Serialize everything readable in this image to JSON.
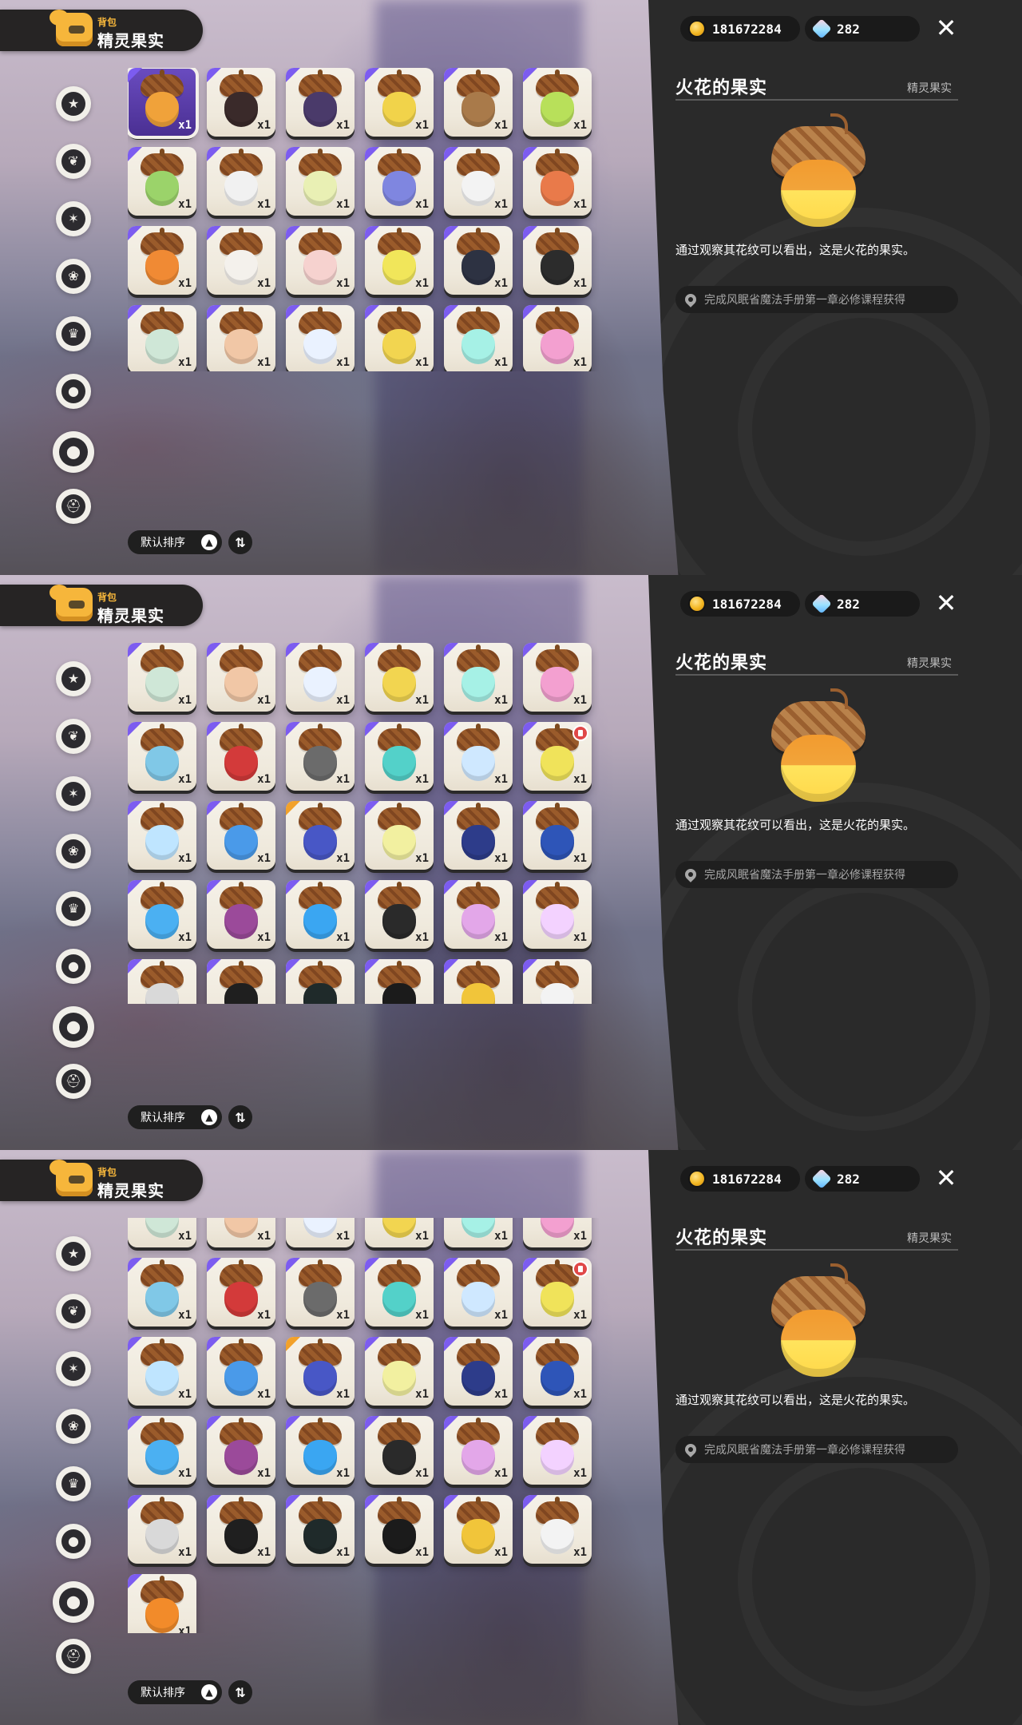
{
  "header": {
    "supertitle": "背包",
    "title": "精灵果实"
  },
  "currency": {
    "coins": "181672284",
    "gems": "282"
  },
  "detail": {
    "name": "火花的果实",
    "type": "精灵果实",
    "description": "通过观察其花纹可以看出，这是火花的果实。",
    "source": "完成风眠省魔法手册第一章必修课程获得"
  },
  "sort": {
    "label": "默认排序"
  },
  "categories": [
    {
      "icon": "star-badge-icon"
    },
    {
      "icon": "leaf-icon"
    },
    {
      "icon": "star-burst-icon"
    },
    {
      "icon": "plant-icon"
    },
    {
      "icon": "crown-book-icon"
    },
    {
      "icon": "orb-icon"
    },
    {
      "icon": "acorn-icon"
    },
    {
      "icon": "helmet-icon"
    }
  ],
  "grid_rows": [
    [
      {
        "count": "x1",
        "selected": true,
        "rarity": "purple",
        "color": "#f0a23a"
      },
      {
        "count": "x1",
        "rarity": "purple",
        "color": "#3a2a2a"
      },
      {
        "count": "x1",
        "rarity": "purple",
        "color": "#4a3a6a"
      },
      {
        "count": "x1",
        "rarity": "purple",
        "color": "#f1d34a"
      },
      {
        "count": "x1",
        "rarity": "purple",
        "color": "#a97a4a"
      },
      {
        "count": "x1",
        "rarity": "purple",
        "color": "#b8e05a"
      }
    ],
    [
      {
        "count": "x1",
        "rarity": "purple",
        "color": "#9bd36a"
      },
      {
        "count": "x1",
        "rarity": "purple",
        "color": "#f1f1f1"
      },
      {
        "count": "x1",
        "rarity": "purple",
        "color": "#e9f0b4"
      },
      {
        "count": "x1",
        "rarity": "purple",
        "color": "#7f86e0"
      },
      {
        "count": "x1",
        "rarity": "purple",
        "color": "#f3f3f3"
      },
      {
        "count": "x1",
        "rarity": "purple",
        "color": "#e97a4a"
      }
    ],
    [
      {
        "count": "x1",
        "rarity": "purple",
        "color": "#f08a34"
      },
      {
        "count": "x1",
        "rarity": "purple",
        "color": "#f4f1ec"
      },
      {
        "count": "x1",
        "rarity": "purple",
        "color": "#f6d2cf"
      },
      {
        "count": "x1",
        "rarity": "purple",
        "color": "#f1e65a"
      },
      {
        "count": "x1",
        "rarity": "purple",
        "color": "#2d3242"
      },
      {
        "count": "x1",
        "rarity": "purple",
        "color": "#2c2c2c"
      }
    ],
    [
      {
        "count": "x1",
        "rarity": "purple",
        "color": "#cfe7d7"
      },
      {
        "count": "x1",
        "rarity": "purple",
        "color": "#f1c7a6"
      },
      {
        "count": "x1",
        "rarity": "purple",
        "color": "#eaf2ff"
      },
      {
        "count": "x1",
        "rarity": "purple",
        "color": "#f2d550"
      },
      {
        "count": "x1",
        "rarity": "purple",
        "color": "#a6f1e6"
      },
      {
        "count": "x1",
        "rarity": "purple",
        "color": "#f3a0d0"
      }
    ],
    [
      {
        "count": "x1",
        "rarity": "purple",
        "color": "#80c8e7"
      },
      {
        "count": "x1",
        "rarity": "purple",
        "color": "#d33a3a"
      },
      {
        "count": "x1",
        "rarity": "purple",
        "color": "#6b6b6b"
      },
      {
        "count": "x1",
        "rarity": "purple",
        "color": "#53d1c9"
      },
      {
        "count": "x1",
        "rarity": "purple",
        "color": "#cfe8ff"
      },
      {
        "count": "x1",
        "rarity": "purple",
        "color": "#f0e35a",
        "badge": true
      }
    ],
    [
      {
        "count": "x1",
        "rarity": "purple",
        "color": "#bfe5ff"
      },
      {
        "count": "x1",
        "rarity": "purple",
        "color": "#4a9ae9"
      },
      {
        "count": "x1",
        "rarity": "gold",
        "color": "#4857c6"
      },
      {
        "count": "x1",
        "rarity": "purple",
        "color": "#f2f0a0"
      },
      {
        "count": "x1",
        "rarity": "purple",
        "color": "#2d3c8a"
      },
      {
        "count": "x1",
        "rarity": "purple",
        "color": "#2e55b8"
      }
    ],
    [
      {
        "count": "x1",
        "rarity": "purple",
        "color": "#4bb0f2"
      },
      {
        "count": "x1",
        "rarity": "purple",
        "color": "#9b4a9a"
      },
      {
        "count": "x1",
        "rarity": "purple",
        "color": "#3aa6f2"
      },
      {
        "count": "x1",
        "rarity": "purple",
        "color": "#2a2a2a"
      },
      {
        "count": "x1",
        "rarity": "purple",
        "color": "#e3a7e9"
      },
      {
        "count": "x1",
        "rarity": "purple",
        "color": "#f3d2ff"
      }
    ],
    [
      {
        "count": "x1",
        "rarity": "purple",
        "color": "#d9d9d9"
      },
      {
        "count": "x1",
        "rarity": "purple",
        "color": "#1f1f1f"
      },
      {
        "count": "x1",
        "rarity": "purple",
        "color": "#1f2a2a"
      },
      {
        "count": "x1",
        "rarity": "purple",
        "color": "#1b1b1b"
      },
      {
        "count": "x1",
        "rarity": "purple",
        "color": "#f1c53a"
      },
      {
        "count": "x1",
        "rarity": "purple",
        "color": "#f3f3f3"
      }
    ],
    [
      {
        "count": "x1",
        "rarity": "purple",
        "color": "#f28b2a"
      }
    ]
  ],
  "screens": [
    {
      "scroll_rows": 0,
      "rows_visible": 6,
      "view_height": 380
    },
    {
      "scroll_rows": 3,
      "rows_visible": 6,
      "view_height": 452
    },
    {
      "scroll_rows": 3.5,
      "rows_visible": 6,
      "view_height": 520
    }
  ],
  "colors": {
    "panel_bg": "#2a2a2a",
    "accent": "#f6b63b",
    "rarity_purple": "#7c5cf0",
    "rarity_gold": "#f2a12a"
  }
}
